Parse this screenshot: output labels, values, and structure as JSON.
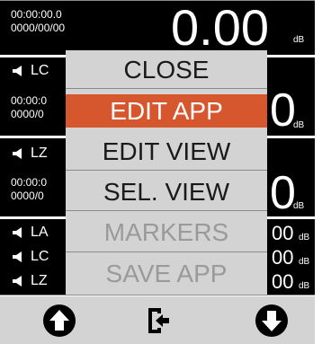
{
  "panels": [
    {
      "timestamp": "00:00:00.0\n0000/00/00",
      "value": "0.00",
      "unit": "dB"
    },
    {
      "label": "LC",
      "timestamp": "00:00:0\n0000/0",
      "value": "0",
      "unit": "dB"
    },
    {
      "label": "LZ",
      "timestamp": "00:00:0\n0000/0",
      "value": "0",
      "unit": "dB"
    }
  ],
  "list_rows": [
    {
      "label": "LA",
      "value": "00",
      "unit": "dB"
    },
    {
      "label": "LC",
      "value": "00",
      "unit": "dB"
    },
    {
      "label": "LZ",
      "value": "00",
      "unit": "dB"
    }
  ],
  "menu": {
    "items": [
      {
        "label": "CLOSE",
        "state": "normal"
      },
      {
        "label": "EDIT APP",
        "state": "selected"
      },
      {
        "label": "EDIT VIEW",
        "state": "normal"
      },
      {
        "label": "SEL. VIEW",
        "state": "normal"
      },
      {
        "label": "MARKERS",
        "state": "disabled"
      },
      {
        "label": "SAVE APP",
        "state": "disabled"
      }
    ],
    "selected_color": "#d6562e"
  },
  "toolbar": {
    "buttons": [
      {
        "icon": "arrow-up-circle-icon"
      },
      {
        "icon": "exit-icon"
      },
      {
        "icon": "arrow-down-circle-icon"
      }
    ]
  }
}
